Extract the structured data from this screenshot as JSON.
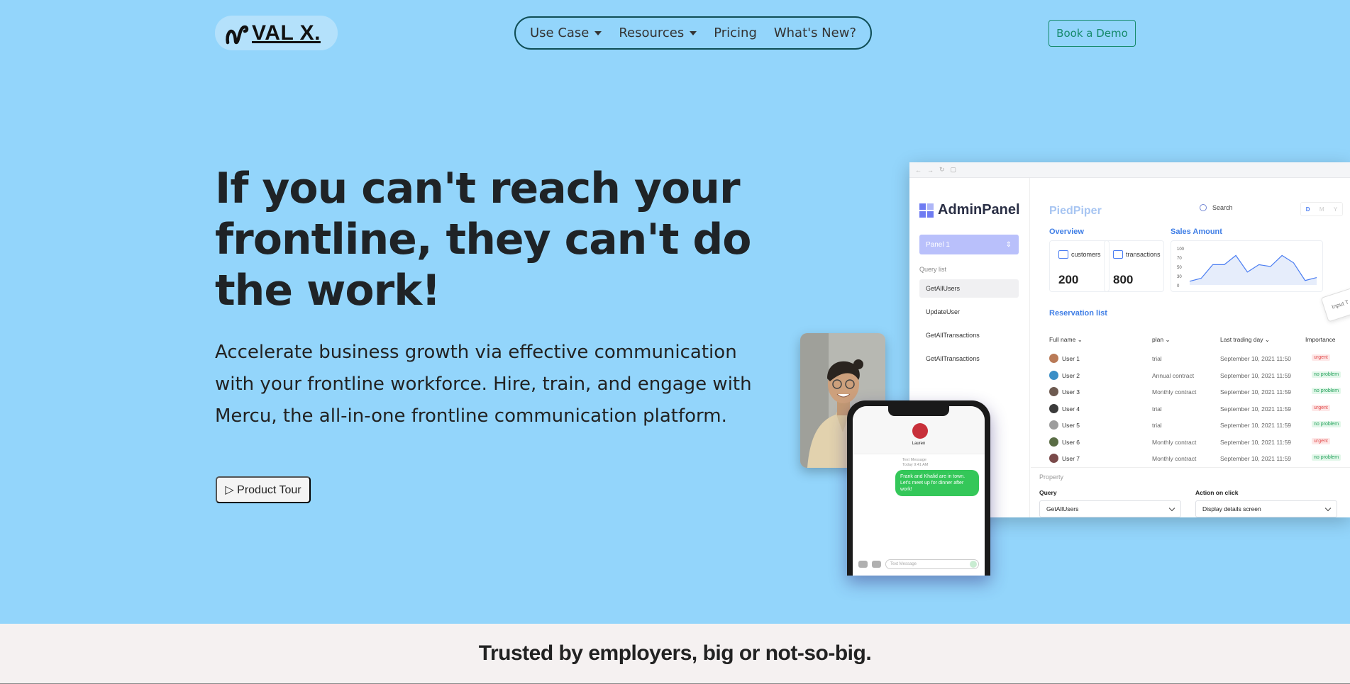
{
  "nav": {
    "logo_text": "VAL X.",
    "items": [
      {
        "label": "Use Case",
        "dropdown": true
      },
      {
        "label": "Resources",
        "dropdown": true
      },
      {
        "label": "Pricing",
        "dropdown": false
      },
      {
        "label": "What's New?",
        "dropdown": false
      }
    ],
    "cta_label": "Book a Demo"
  },
  "hero": {
    "title": "If you can't reach your frontline, they can't do the work!",
    "description": "Accelerate business growth via effective communication with your frontline workforce. Hire, train, and engage with Mercu, the all-in-one frontline communication platform.",
    "tour_label": "▷ Product Tour"
  },
  "admin_panel": {
    "brand": "AdminPanel",
    "panel_select": "Panel 1",
    "query_list_label": "Query list",
    "queries": [
      "GetAllUsers",
      "UpdateUser",
      "GetAllTransactions",
      "GetAllTransactions"
    ],
    "title": "PiedPiper",
    "search_label": "Search",
    "range": [
      "D",
      "M",
      "Y"
    ],
    "overview_label": "Overview",
    "sales_label": "Sales Amount",
    "kpis": [
      {
        "label": "customers",
        "value": "200"
      },
      {
        "label": "transactions",
        "value": "800"
      }
    ],
    "sales_axis": [
      "100",
      "70",
      "50",
      "30",
      "0"
    ],
    "sales_series": [
      10,
      18,
      55,
      55,
      80,
      35,
      55,
      50,
      80,
      60,
      12,
      20
    ],
    "reservation_label": "Reservation list",
    "columns": [
      "Full name",
      "plan",
      "Last trading day",
      "Importance"
    ],
    "rows": [
      {
        "name": "User 1",
        "plan": "trial",
        "date": "September 10, 2021 11:50",
        "tag": "urgent",
        "status": "urgent",
        "avatar": "#b97a57"
      },
      {
        "name": "User 2",
        "plan": "Annual contract",
        "date": "September 10, 2021 11:59",
        "tag": "no problem",
        "status": "ok",
        "avatar": "#3a8ec6"
      },
      {
        "name": "User 3",
        "plan": "Monthly contract",
        "date": "September 10, 2021 11:59",
        "tag": "no problem",
        "status": "ok",
        "avatar": "#6d5a50"
      },
      {
        "name": "User 4",
        "plan": "trial",
        "date": "September 10, 2021 11:59",
        "tag": "urgent",
        "status": "urgent",
        "avatar": "#3b3b3b"
      },
      {
        "name": "User 5",
        "plan": "trial",
        "date": "September 10, 2021 11:59",
        "tag": "no problem",
        "status": "ok",
        "avatar": "#9c9c9c"
      },
      {
        "name": "User 6",
        "plan": "Monthly contract",
        "date": "September 10, 2021 11:59",
        "tag": "urgent",
        "status": "urgent",
        "avatar": "#5a6d45"
      },
      {
        "name": "User 7",
        "plan": "Monthly contract",
        "date": "September 10, 2021 11:59",
        "tag": "no problem",
        "status": "ok",
        "avatar": "#7a4a4a"
      }
    ],
    "property_label": "Property",
    "query_field_label": "Query",
    "query_field_value": "GetAllUsers",
    "action_field_label": "Action on click",
    "action_field_value": "Display details screen",
    "input_tag": "Input T"
  },
  "phone": {
    "contact_name": "Lauren",
    "meta_line1": "Text Message",
    "meta_line2": "Today 9:41 AM",
    "message": "Frank and Khalid are in town. Let's meet up for dinner after work!",
    "input_placeholder": "Text Message"
  },
  "trusted": {
    "heading": "Trusted by employers, big or not-so-big."
  }
}
